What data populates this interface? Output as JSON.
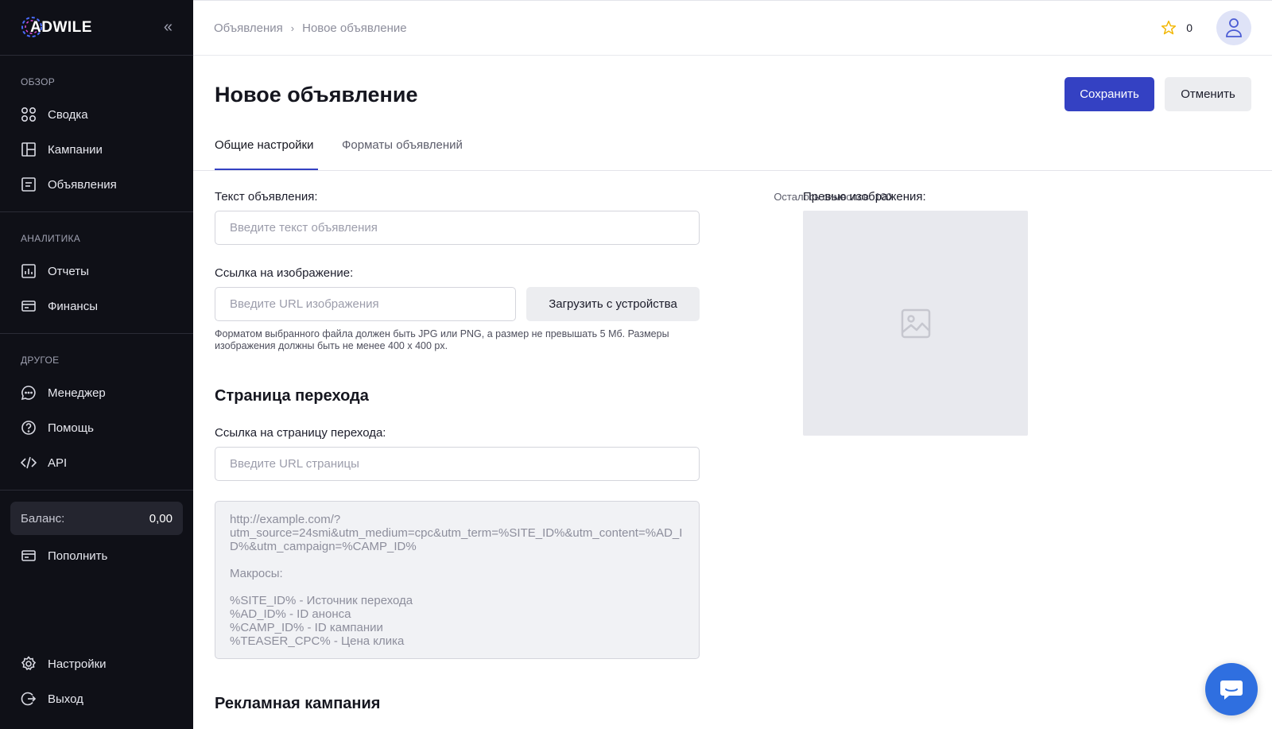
{
  "brand": {
    "name": "ADWILE"
  },
  "sidebar": {
    "sections": [
      {
        "title": "ОБЗОР",
        "items": [
          {
            "label": "Сводка",
            "icon": "dashboard-icon"
          },
          {
            "label": "Кампании",
            "icon": "campaigns-icon"
          },
          {
            "label": "Объявления",
            "icon": "ads-icon"
          }
        ]
      },
      {
        "title": "АНАЛИТИКА",
        "items": [
          {
            "label": "Отчеты",
            "icon": "reports-icon"
          },
          {
            "label": "Финансы",
            "icon": "finance-icon"
          }
        ]
      },
      {
        "title": "ДРУГОЕ",
        "items": [
          {
            "label": "Менеджер",
            "icon": "chat-icon"
          },
          {
            "label": "Помощь",
            "icon": "help-icon"
          },
          {
            "label": "API",
            "icon": "code-icon"
          }
        ]
      }
    ],
    "balance": {
      "label": "Баланс:",
      "value": "0,00"
    },
    "topup": "Пополнить",
    "settings": "Настройки",
    "logout": "Выход"
  },
  "header": {
    "breadcrumb": [
      "Объявления",
      "Новое объявление"
    ],
    "favorites_count": "0"
  },
  "page": {
    "title": "Новое объявление",
    "save": "Сохранить",
    "cancel": "Отменить",
    "tabs": [
      "Общие настройки",
      "Форматы объявлений"
    ]
  },
  "form": {
    "ad_text_label": "Текст объявления:",
    "chars_left": "Осталось символов: 100",
    "ad_text_placeholder": "Введите текст объявления",
    "image_link_label": "Ссылка на изображение:",
    "image_url_placeholder": "Введите URL изображения",
    "upload_button": "Загрузить с устройства",
    "image_note": "Форматом выбранного файла должен быть JPG или PNG, а размер не превышать 5 Мб. Размеры изображения должны быть не менее 400 х 400 px.",
    "landing_heading": "Страница перехода",
    "landing_label": "Ссылка на страницу перехода:",
    "landing_placeholder": "Введите URL страницы",
    "macros_text": "http://example.com/?\nutm_source=24smi&utm_medium=cpc&utm_term=%SITE_ID%&utm_content=%AD_ID%&utm_campaign=%CAMP_ID%\n\nМакросы:\n\n%SITE_ID% - Источник перехода\n%AD_ID% - ID анонса\n%CAMP_ID% - ID кампании\n%TEASER_CPC% - Цена клика",
    "campaign_heading": "Рекламная кампания",
    "preview_label": "Превью изображения:"
  },
  "colors": {
    "primary": "#3441c3",
    "sidebar_bg": "#0f1017",
    "chat": "#2f6fe0"
  }
}
